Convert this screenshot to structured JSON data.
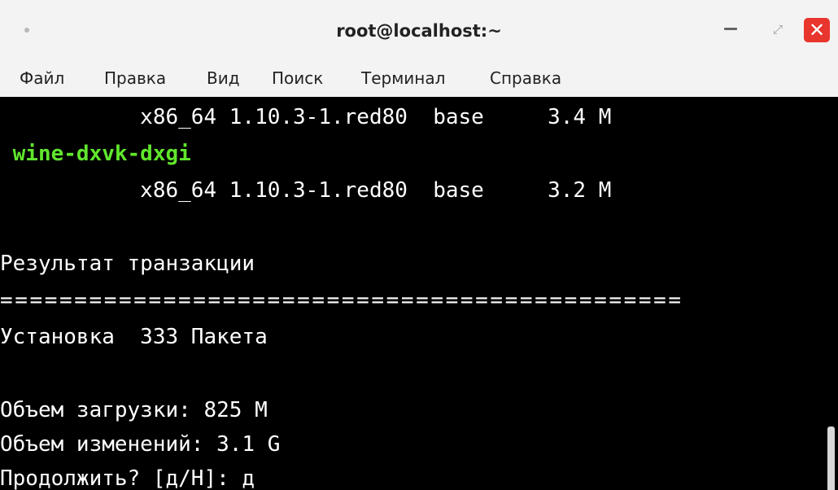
{
  "window": {
    "title": "root@localhost:~",
    "controls": {
      "minimize_icon": "minimize-icon",
      "maximize_icon": "maximize-icon",
      "close_icon": "close-icon",
      "close_color": "#e8352e"
    }
  },
  "menu": [
    "Файл",
    "Правка",
    "Вид",
    "Поиск",
    "Терминал",
    "Справка"
  ],
  "terminal": {
    "background": "#000000",
    "package_color": "#60e62c",
    "lines": [
      "           x86_64 1.10.3-1.red80  base     3.4 M",
      " wine-dxvk-dxgi",
      "           x86_64 1.10.3-1.red80  base     3.2 M",
      "",
      "Результат транзакции",
      "==============================================",
      "Установка  333 Пакета",
      "",
      "Объем загрузки: 825 M",
      "Объем изменений: 3.1 G",
      "Продолжить? [д/Н]: д"
    ]
  }
}
